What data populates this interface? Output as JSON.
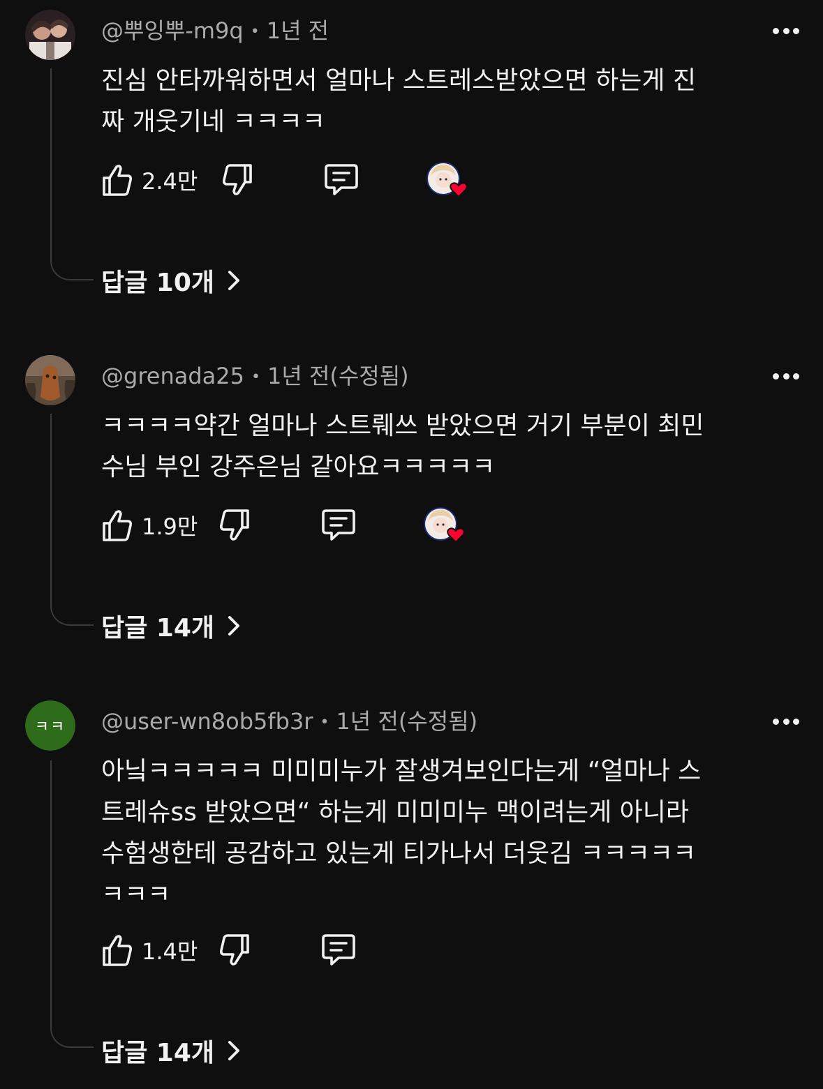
{
  "comments": [
    {
      "handle": "@뿌잉뿌-m9q",
      "time": "1년 전",
      "text_lines": [
        "진심 안타까워하면서 얼마나 스트레스받았으면 하는게 진",
        "짜 개웃기네 ㅋㅋㅋㅋ"
      ],
      "likes": "2.4만",
      "creator_heart": true,
      "replies_label": "답글 10개",
      "avatar": "photo"
    },
    {
      "handle": "@grenada25",
      "time": "1년 전(수정됨)",
      "text_lines": [
        "ㅋㅋㅋㅋ약간 얼마나 스트뤠쓰 받았으면 거기 부분이 최민",
        "수님 부인 강주은님 같아요ㅋㅋㅋㅋㅋ"
      ],
      "likes": "1.9만",
      "creator_heart": true,
      "replies_label": "답글 14개",
      "avatar": "photo"
    },
    {
      "handle": "@user-wn8ob5fb3r",
      "time": "1년 전(수정됨)",
      "text_lines": [
        "아닠ㅋㅋㅋㅋㅋ 미미미누가 잘생겨보인다는게 “얼마나 스",
        "트레슈ss 받았으면“ 하는게 미미미누 맥이려는게 아니라",
        "수험생한테 공감하고 있는게 티가나서 더웃김 ㅋㅋㅋㅋㅋ",
        "ㅋㅋㅋ"
      ],
      "likes": "1.4만",
      "creator_heart": false,
      "replies_label": "답글 14개",
      "avatar": "initials",
      "avatar_initials": "ㅋㅋ",
      "avatar_color": "#2e6b1a"
    }
  ],
  "icons": {
    "like": "thumbs-up-icon",
    "dislike": "thumbs-down-icon",
    "reply": "comment-icon",
    "more": "more-vertical-icon",
    "chevron": "chevron-right-icon",
    "heart": "creator-heart-icon"
  },
  "colors": {
    "background": "#0f0f0f",
    "text": "#f1f1f1",
    "meta": "#aaaaaa",
    "heart": "#ff0033",
    "thread_line": "#3a3a3a"
  }
}
